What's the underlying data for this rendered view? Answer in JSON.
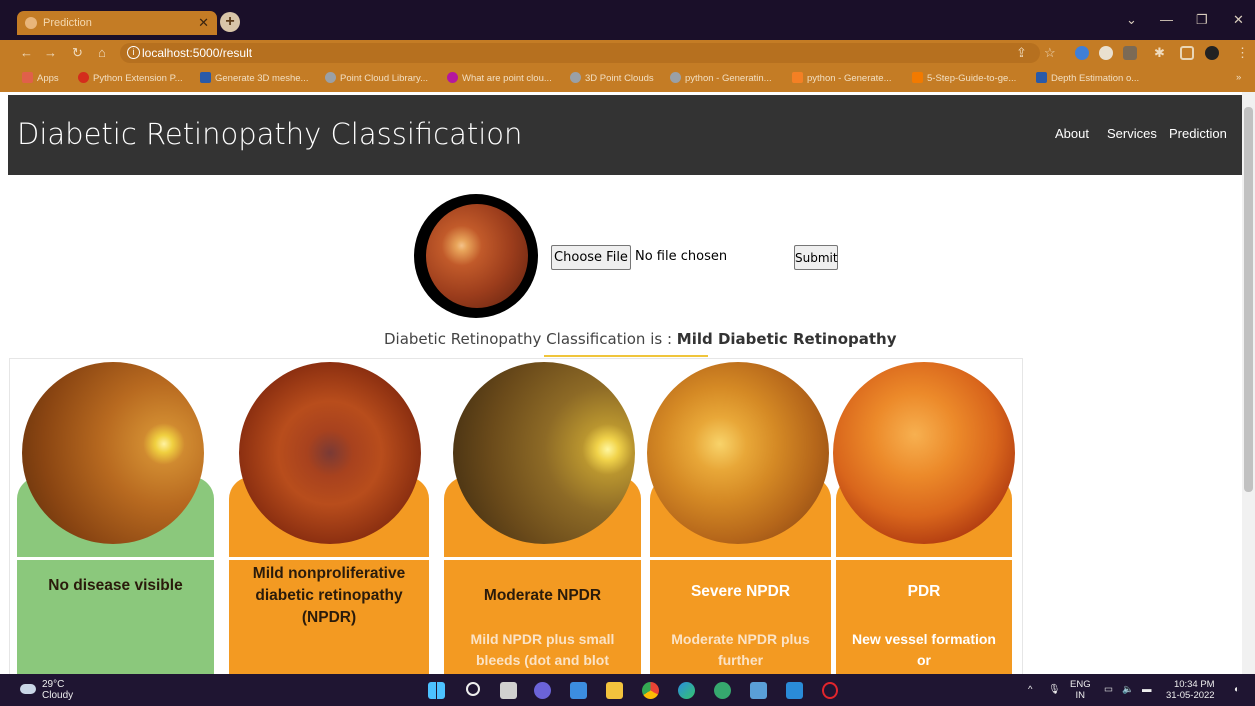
{
  "browser": {
    "tab_title": "Prediction",
    "url": "localhost:5000/result",
    "bookmarks": [
      "Apps",
      "Python Extension P...",
      "Generate 3D meshe...",
      "Point Cloud Library...",
      "What are point clou...",
      "3D Point Clouds",
      "python - Generatin...",
      "python - Generate...",
      "5-Step-Guide-to-ge...",
      "Depth Estimation o..."
    ]
  },
  "site": {
    "title": "Diabetic Retinopathy Classification",
    "nav": [
      "About",
      "Services",
      "Prediction"
    ]
  },
  "upload": {
    "choose_label": "Choose File",
    "file_status": "No file chosen",
    "submit_label": "Submit"
  },
  "result": {
    "label": "Diabetic Retinopathy Classification is : ",
    "value": "Mild Diabetic Retinopathy"
  },
  "stages": [
    {
      "title": "No disease visible",
      "description": "",
      "color": "#8bc87c"
    },
    {
      "title": "Mild nonproliferative diabetic retinopathy (NPDR)",
      "description": "",
      "color": "#f39a22"
    },
    {
      "title": "Moderate NPDR",
      "description": "Mild NPDR plus small bleeds (dot and blot",
      "color": "#f39a22"
    },
    {
      "title": "Severe NPDR",
      "description": "Moderate NPDR plus further",
      "color": "#f39a22"
    },
    {
      "title": "PDR",
      "description": "New vessel formation or",
      "color": "#f39a22"
    }
  ],
  "taskbar": {
    "temperature": "29°C",
    "weather": "Cloudy",
    "language_line1": "ENG",
    "language_line2": "IN",
    "time": "10:34 PM",
    "date": "31-05-2022"
  },
  "colors": {
    "titlebar": "#1a0f29",
    "chrome_orange": "#c47c25",
    "navbar": "#333333",
    "accent_underline": "#f0c53b"
  }
}
